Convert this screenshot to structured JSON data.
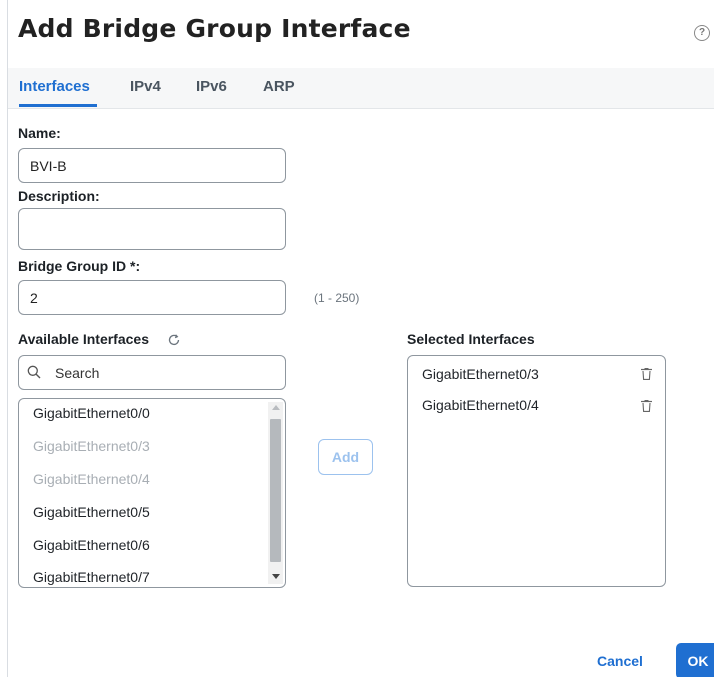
{
  "dialog": {
    "title": "Add Bridge Group Interface",
    "help_icon": "help-circle-icon",
    "help_glyph": "?"
  },
  "tabs": [
    {
      "label": "Interfaces",
      "active": true
    },
    {
      "label": "IPv4",
      "active": false
    },
    {
      "label": "IPv6",
      "active": false
    },
    {
      "label": "ARP",
      "active": false
    }
  ],
  "form": {
    "name_label": "Name:",
    "name_value": "BVI-B",
    "description_label": "Description:",
    "description_value": "",
    "bridge_group_id_label": "Bridge Group ID *:",
    "bridge_group_id_value": "2",
    "bridge_group_id_range": "(1 - 250)"
  },
  "available": {
    "label": "Available Interfaces",
    "refresh_icon": "refresh-icon",
    "search_placeholder": "Search",
    "items": [
      {
        "label": "GigabitEthernet0/0",
        "disabled": false
      },
      {
        "label": "GigabitEthernet0/3",
        "disabled": true
      },
      {
        "label": "GigabitEthernet0/4",
        "disabled": true
      },
      {
        "label": "GigabitEthernet0/5",
        "disabled": false
      },
      {
        "label": "GigabitEthernet0/6",
        "disabled": false
      },
      {
        "label": "GigabitEthernet0/7",
        "disabled": false
      }
    ]
  },
  "add_button_label": "Add",
  "selected": {
    "label": "Selected Interfaces",
    "items": [
      {
        "label": "GigabitEthernet0/3"
      },
      {
        "label": "GigabitEthernet0/4"
      }
    ]
  },
  "footer": {
    "cancel_label": "Cancel",
    "ok_label": "OK"
  },
  "colors": {
    "accent": "#1f6fd1",
    "disabled_text": "#a8aeb4",
    "add_button_disabled": "#9cc2ee"
  }
}
